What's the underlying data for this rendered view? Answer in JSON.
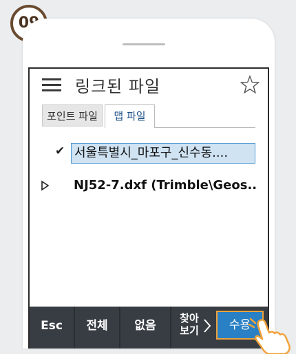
{
  "badge": {
    "step": "09"
  },
  "header": {
    "title": "링크된 파일"
  },
  "tabs": [
    {
      "label": "포인트 파일",
      "active": false
    },
    {
      "label": "맵 파일",
      "active": true
    }
  ],
  "files": [
    {
      "name": "서울특별시_마포구_신수동....",
      "checked": true,
      "selected": true
    },
    {
      "name": "NJ52-7.dxf (Trimble\\Geos...",
      "checked": false,
      "selected": false
    }
  ],
  "toolbar": {
    "esc": "Esc",
    "select_all": "전체",
    "select_none": "없음",
    "browse_line1": "찾아",
    "browse_line2": "보기",
    "accept": "수용"
  },
  "colors": {
    "accent": "#2980c4",
    "highlight_border": "#f0a23b",
    "selection_fill": "#cfe3f3",
    "toolbar_bg": "#383d44"
  },
  "icons": [
    "menu-icon",
    "star-icon",
    "check-icon",
    "expand-arrow-icon",
    "chevron-right-icon",
    "pointing-hand-icon"
  ]
}
